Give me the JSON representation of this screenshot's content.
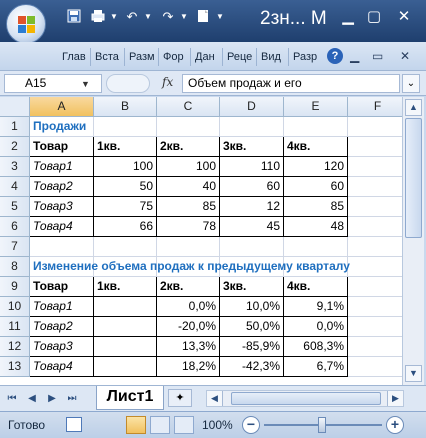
{
  "titlebar": {
    "title": "2зн... М",
    "qat": [
      "save-icon",
      "print-icon",
      "undo-icon",
      "redo-icon",
      "customize-icon"
    ]
  },
  "ribbon": {
    "tabs": [
      "Глав",
      "Вста",
      "Разм",
      "Фор",
      "Дан",
      "Реце",
      "Вид",
      "Разр"
    ],
    "help": "?"
  },
  "formula_bar": {
    "name_box": "A15",
    "fx_label": "fx",
    "formula": "Объем продаж и его"
  },
  "grid": {
    "columns": [
      "A",
      "B",
      "C",
      "D",
      "E",
      "F"
    ],
    "rows": [
      "1",
      "2",
      "3",
      "4",
      "5",
      "6",
      "7",
      "8",
      "9",
      "10",
      "11",
      "12",
      "13"
    ],
    "title1": "Продажи",
    "table1": {
      "header": [
        "Товар",
        "1кв.",
        "2кв.",
        "3кв.",
        "4кв."
      ],
      "rows": [
        [
          "Товар1",
          "100",
          "100",
          "110",
          "120"
        ],
        [
          "Товар2",
          "50",
          "40",
          "60",
          "60"
        ],
        [
          "Товар3",
          "75",
          "85",
          "12",
          "85"
        ],
        [
          "Товар4",
          "66",
          "78",
          "45",
          "48"
        ]
      ]
    },
    "title2": "Изменение объема продаж к предыдущему кварталу",
    "table2": {
      "header": [
        "Товар",
        "1кв.",
        "2кв.",
        "3кв.",
        "4кв."
      ],
      "rows": [
        [
          "Товар1",
          "",
          "0,0%",
          "10,0%",
          "9,1%"
        ],
        [
          "Товар2",
          "",
          "-20,0%",
          "50,0%",
          "0,0%"
        ],
        [
          "Товар3",
          "",
          "13,3%",
          "-85,9%",
          "608,3%"
        ],
        [
          "Товар4",
          "",
          "18,2%",
          "-42,3%",
          "6,7%"
        ]
      ]
    }
  },
  "sheets": {
    "active": "Лист1"
  },
  "status": {
    "text": "Готово",
    "zoom": "100%"
  }
}
